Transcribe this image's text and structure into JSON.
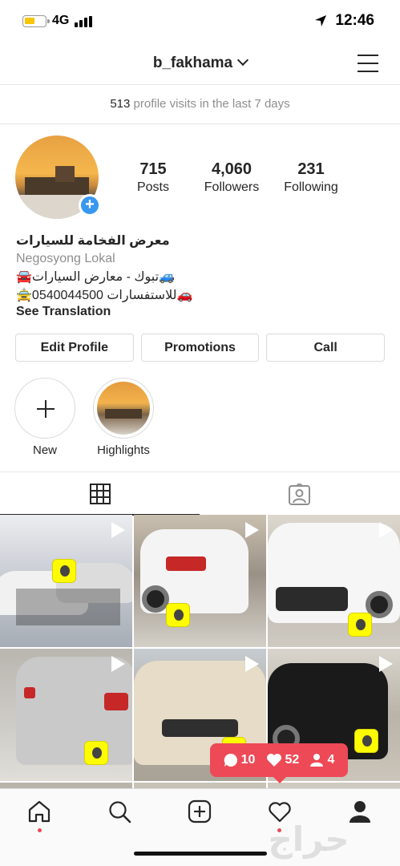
{
  "status_bar": {
    "network": "4G",
    "time": "12:46"
  },
  "header": {
    "username": "b_fakhama"
  },
  "insights": {
    "visits_count": "513",
    "visits_text": " profile visits in the last 7 days"
  },
  "profile": {
    "stats": [
      {
        "value": "715",
        "label": "Posts"
      },
      {
        "value": "4,060",
        "label": "Followers"
      },
      {
        "value": "231",
        "label": "Following"
      }
    ],
    "bio": {
      "name": "معرض الفخامة للسيارات",
      "category": "Negosyong Lokal",
      "line1": "🚘تبوك - معارض السيارات🚙",
      "line2": "🚖للاستفسارات 0540044500🚗",
      "translate": "See Translation"
    },
    "buttons": {
      "edit": "Edit Profile",
      "promotions": "Promotions",
      "call": "Call"
    }
  },
  "highlights": [
    {
      "label": "New"
    },
    {
      "label": "Highlights"
    }
  ],
  "activity": {
    "comments": "10",
    "likes": "52",
    "follows": "4"
  },
  "watermark": "حراج",
  "colors": {
    "accent_blue": "#3897f0",
    "badge_red": "#ed4956",
    "text": "#262626",
    "muted": "#8e8e8e"
  }
}
